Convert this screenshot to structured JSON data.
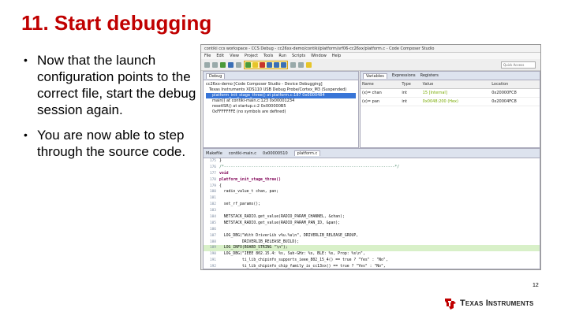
{
  "slide": {
    "title": "11. Start debugging",
    "bullets": [
      "Now that the launch configuration points to the correct file, start the debug session again.",
      "You are now able to step through the source code."
    ],
    "bullet_symbol": "•",
    "page_number": "12",
    "logo_text": "Texas Instruments",
    "brand_color": "#c00000",
    "logo_icon": "ti-logo-icon"
  },
  "ide": {
    "window_title": "contiki ccs workspace - CCS Debug - cc26xx-demo/contiki/platform/srf06-cc26xx/platform.c - Code Composer Studio",
    "menu": [
      "File",
      "Edit",
      "View",
      "Project",
      "Tools",
      "Run",
      "Scripts",
      "Window",
      "Help"
    ],
    "quick_access": "Quick Access",
    "debug_tab": "Debug",
    "debug_tree": [
      "cc26xx-demo [Code Composer Studio - Device Debugging]",
      "Texas Instruments XDS110 USB Debug Probe/Cortex_M3 (Suspended)",
      "platform_init_stage_three() at platform.c:187 0x0000484",
      "main() at contiki-main.c:123 0x00001234",
      "resetISR() at startup.c:2 0x000000B5",
      "0xFFFFFFFE (no symbols are defined)"
    ],
    "vars_tabs": [
      "Variables",
      "Expressions",
      "Registers"
    ],
    "vars_headers": [
      "Name",
      "Type",
      "Value",
      "Location"
    ],
    "vars_rows": [
      [
        "(x)= chan",
        "int",
        "15 [Internal]",
        "0x20000FC8"
      ],
      [
        "(x)= pan",
        "int",
        "0x0048:200 (Hex)",
        "0x20004FC8"
      ]
    ],
    "editor_tabs": [
      "Makefile",
      "contiki-main.c",
      "0x00000510",
      "platform.c"
    ],
    "code_lines": [
      {
        "num": "175",
        "text": "}"
      },
      {
        "num": "176",
        "text": "/*---------------------------------------------------------------------------*/"
      },
      {
        "num": "177",
        "text": "void"
      },
      {
        "num": "178",
        "text": "platform_init_stage_three()"
      },
      {
        "num": "179",
        "text": "{"
      },
      {
        "num": "180",
        "text": "  radio_value_t chan, pan;"
      },
      {
        "num": "181",
        "text": ""
      },
      {
        "num": "182",
        "text": "  set_rf_params();"
      },
      {
        "num": "183",
        "text": ""
      },
      {
        "num": "184",
        "text": "  NETSTACK_RADIO.get_value(RADIO_PARAM_CHANNEL, &chan);"
      },
      {
        "num": "185",
        "text": "  NETSTACK_RADIO.get_value(RADIO_PARAM_PAN_ID, &pan);"
      },
      {
        "num": "186",
        "text": ""
      },
      {
        "num": "187",
        "text": "  LOG_DBG(\"With DriverLib v%u.%u\\n\", DRIVERLIB_RELEASE_GROUP,"
      },
      {
        "num": "188",
        "text": "          DRIVERLIB_RELEASE_BUILD);"
      },
      {
        "num": "189",
        "text": "  LOG_INFO(BOARD_STRING \"\\n\");"
      },
      {
        "num": "190",
        "text": "  LOG_DBG(\"IEEE 802.15.4: %s, Sub-GHz: %s, BLE: %s, Prop: %s\\n\","
      },
      {
        "num": "191",
        "text": "          ti_lib_chipinfo_supports_ieee_802_15_4() == true ? \"Yes\" : \"No\","
      },
      {
        "num": "192",
        "text": "          ti_lib_chipinfo_chip_family_is_cc13xx() == true ? \"Yes\" : \"No\","
      }
    ],
    "highlighted_line": "189"
  }
}
